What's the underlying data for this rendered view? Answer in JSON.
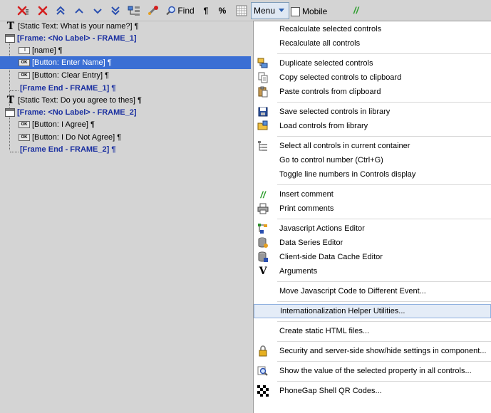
{
  "toolbar": {
    "find_label": "Find",
    "pilcrow_label": "¶",
    "percent_label": "%",
    "menu_label": "Menu",
    "mobile_label": "Mobile",
    "comment_label": "//"
  },
  "tree": {
    "rows": [
      {
        "icon": "T",
        "text": "[Static Text: What is your name?] ¶"
      },
      {
        "icon": "frame",
        "text": "[Frame: <No Label> - FRAME_1]"
      },
      {
        "icon": "input",
        "text": "[name] ¶"
      },
      {
        "icon": "ok",
        "text": "[Button: Enter Name] ¶",
        "selected": true
      },
      {
        "icon": "ok",
        "text": "[Button: Clear Entry] ¶"
      },
      {
        "icon": "end",
        "text": "[Frame End - FRAME_1] ¶"
      },
      {
        "icon": "T",
        "text": "[Static Text: Do you agree to thes] ¶"
      },
      {
        "icon": "frame",
        "text": "[Frame: <No Label> - FRAME_2]"
      },
      {
        "icon": "ok",
        "text": "[Button: I Agree] ¶"
      },
      {
        "icon": "ok",
        "text": "[Button: I Do Not Agree] ¶"
      },
      {
        "icon": "end",
        "text": "[Frame End - FRAME_2] ¶"
      }
    ]
  },
  "menu": {
    "items": [
      {
        "label": "Recalculate selected controls",
        "icon": ""
      },
      {
        "label": "Recalculate all controls",
        "icon": ""
      },
      {
        "label": "Duplicate selected controls",
        "icon": "duplicate-icon"
      },
      {
        "label": "Copy selected controls to clipboard",
        "icon": "copy-icon"
      },
      {
        "label": "Paste controls from clipboard",
        "icon": "paste-icon"
      },
      {
        "label": "Save selected controls in library",
        "icon": "save-icon"
      },
      {
        "label": "Load controls from library",
        "icon": "load-folder-icon"
      },
      {
        "label": "Select all controls in current container",
        "icon": "select-tree-icon"
      },
      {
        "label": "Go to control number (Ctrl+G)",
        "icon": ""
      },
      {
        "label": "Toggle line numbers in Controls display",
        "icon": ""
      },
      {
        "label": "Insert comment",
        "icon": "comment-icon",
        "icon_text": "//"
      },
      {
        "label": "Print comments",
        "icon": "printer-icon"
      },
      {
        "label": "Javascript Actions Editor",
        "icon": "js-actions-icon"
      },
      {
        "label": "Data Series Editor",
        "icon": "database-icon"
      },
      {
        "label": "Client-side Data Cache Editor",
        "icon": "database-cache-icon"
      },
      {
        "label": "Arguments",
        "icon": "arguments-icon",
        "icon_text": "V"
      },
      {
        "label": "Move Javascript Code to Different Event...",
        "icon": ""
      },
      {
        "label": "Internationalization Helper Utilities...",
        "icon": "",
        "highlighted": true
      },
      {
        "label": "Create static HTML files...",
        "icon": ""
      },
      {
        "label": "Security and server-side show/hide settings in component...",
        "icon": "lock-icon"
      },
      {
        "label": "Show the value of the selected property in all controls...",
        "icon": "magnifier-icon"
      },
      {
        "label": "PhoneGap Shell QR Codes...",
        "icon": "qr-code-icon"
      }
    ]
  },
  "colors": {
    "selection": "#3b6fd4",
    "frame_text": "#1a2fa0",
    "comment_green": "#2e9e2e",
    "menu_highlight": "#e4ecf7"
  }
}
